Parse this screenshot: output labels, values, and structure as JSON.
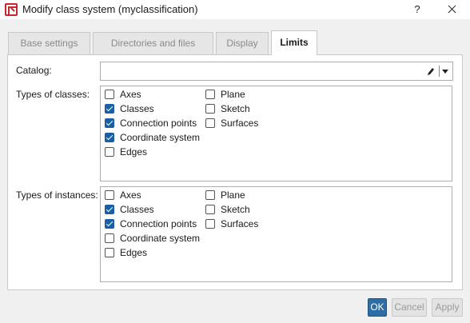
{
  "window": {
    "title": "Modify class system (myclassification)",
    "help_label": "?"
  },
  "tabs": [
    {
      "label": "Base settings"
    },
    {
      "label": "Directories and files"
    },
    {
      "label": "Display"
    },
    {
      "label": "Limits"
    }
  ],
  "active_tab": "Limits",
  "catalog": {
    "label": "Catalog:",
    "value": ""
  },
  "types_of_classes": {
    "label": "Types of classes:",
    "items": [
      {
        "label": "Axes",
        "checked": false
      },
      {
        "label": "Classes",
        "checked": true
      },
      {
        "label": "Connection points",
        "checked": true
      },
      {
        "label": "Coordinate system",
        "checked": true
      },
      {
        "label": "Edges",
        "checked": false
      },
      {
        "label": "Plane",
        "checked": false
      },
      {
        "label": "Sketch",
        "checked": false
      },
      {
        "label": "Surfaces",
        "checked": false
      }
    ]
  },
  "types_of_instances": {
    "label": "Types of instances:",
    "items": [
      {
        "label": "Axes",
        "checked": false
      },
      {
        "label": "Classes",
        "checked": true
      },
      {
        "label": "Connection points",
        "checked": true
      },
      {
        "label": "Coordinate system",
        "checked": false
      },
      {
        "label": "Edges",
        "checked": false
      },
      {
        "label": "Plane",
        "checked": false
      },
      {
        "label": "Sketch",
        "checked": false
      },
      {
        "label": "Surfaces",
        "checked": false
      }
    ]
  },
  "buttons": {
    "ok": "OK",
    "cancel": "Cancel",
    "apply": "Apply"
  },
  "colors": {
    "accent": "#2d6ea6",
    "checkbox_checked": "#1a5fa5"
  }
}
